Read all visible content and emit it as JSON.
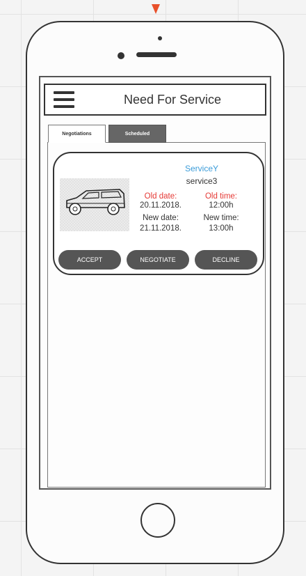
{
  "app": {
    "title": "Need For Service"
  },
  "tabs": [
    {
      "label": "Negotiations",
      "active": true
    },
    {
      "label": "Scheduled",
      "active": false
    }
  ],
  "card": {
    "service_name": "ServiceY",
    "service_sub": "service3",
    "old_date_label": "Old date:",
    "old_date_value": "20.11.2018.",
    "old_time_label": "Old time:",
    "old_time_value": "12:00h",
    "new_date_label": "New date:",
    "new_date_value": "21.11.2018.",
    "new_time_label": "New time:",
    "new_time_value": "13:00h",
    "buttons": {
      "accept": "ACCEPT",
      "negotiate": "NEGOTIATE",
      "decline": "DECLINE"
    }
  },
  "colors": {
    "service_name": "#3b9cd9",
    "old_labels": "#e53935",
    "button_bg": "#555555",
    "active_tab_bg": "#ffffff",
    "inactive_tab_bg": "#666666",
    "pointer_arrow": "#e8502a"
  },
  "icons": {
    "menu": "hamburger-icon",
    "vehicle": "car-icon"
  }
}
